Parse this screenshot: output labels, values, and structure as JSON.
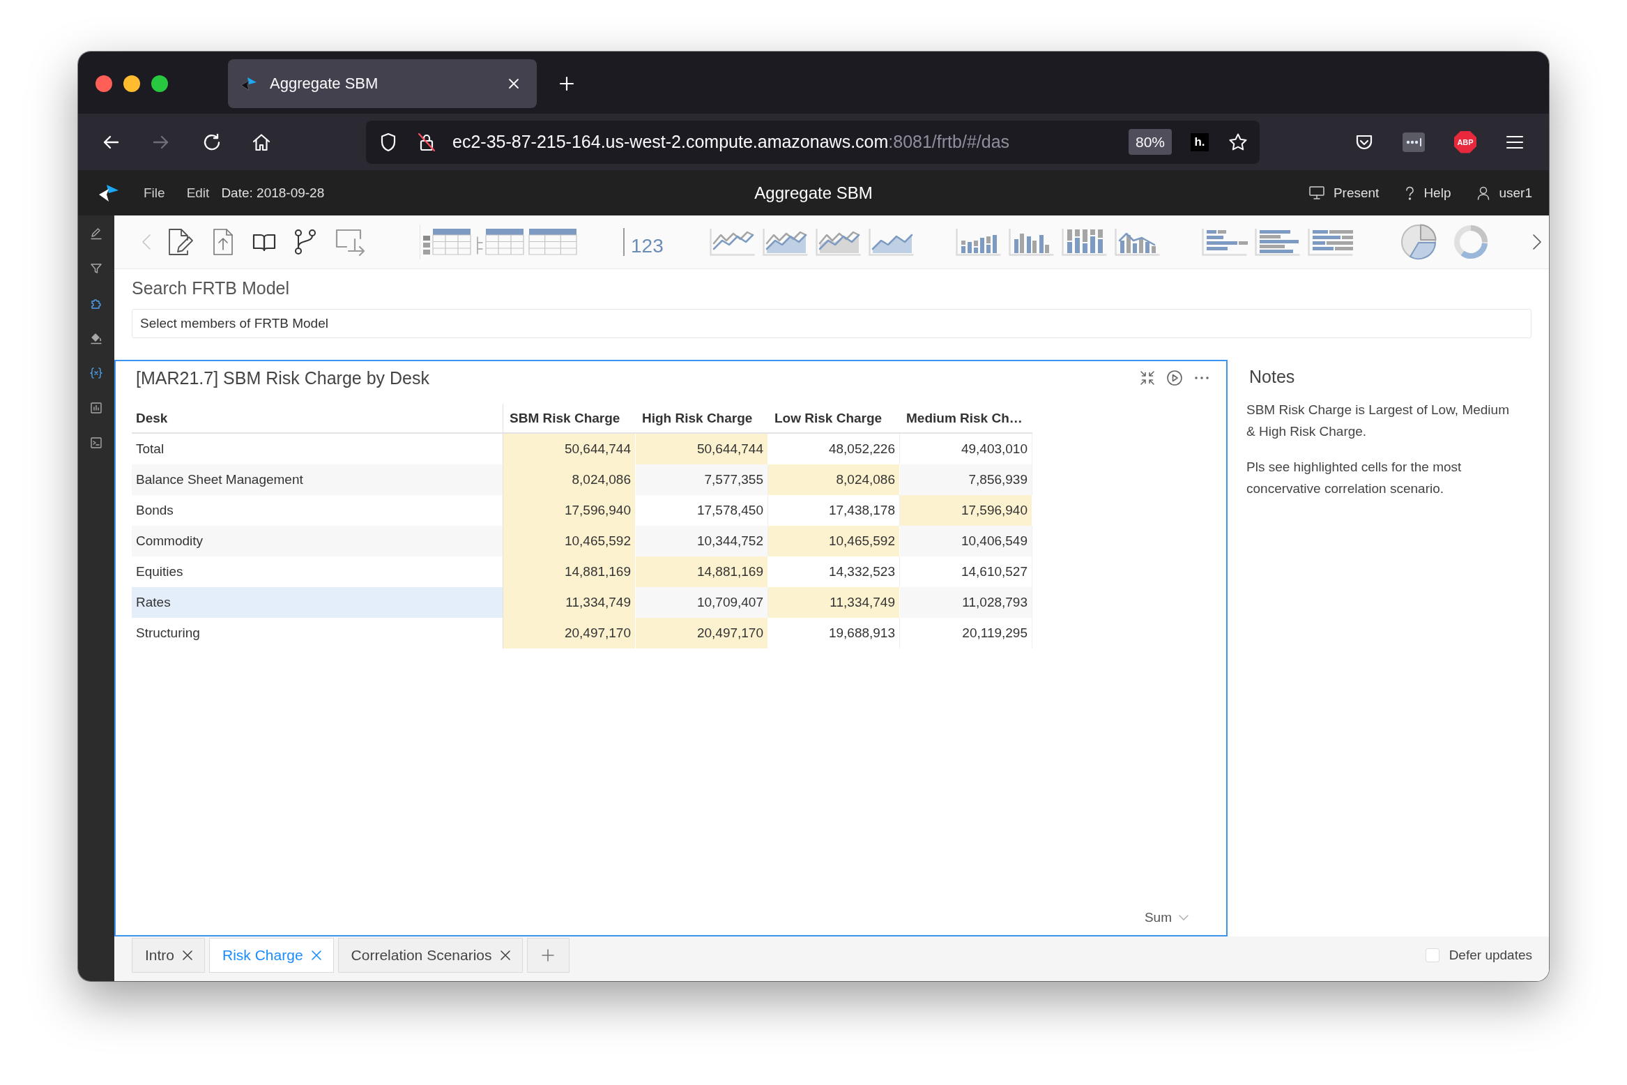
{
  "browser": {
    "tabs": [
      {
        "title": "Aggregate SBM",
        "selected": true
      }
    ],
    "url": {
      "host": "ec2-35-87-215-164.us-west-2.compute.amazonaws.com",
      "path": ":8081/frtb/#/das"
    },
    "zoom": "80%",
    "extensions": [
      {
        "kind": "square",
        "label": "h."
      },
      {
        "kind": "octagon",
        "label": "ABP"
      }
    ]
  },
  "app": {
    "menu": [
      "File",
      "Edit"
    ],
    "date": "Date: 2018-09-28",
    "title": "Aggregate SBM",
    "actions": [
      {
        "kind": "present",
        "label": "Present"
      },
      {
        "kind": "help",
        "label": "Help"
      },
      {
        "kind": "user",
        "label": "user1"
      }
    ]
  },
  "toolbar": {
    "kpi": "123"
  },
  "search": {
    "title": "Search FRTB Model",
    "placeholder": "Select members of FRTB Model"
  },
  "widget": {
    "title": "[MAR21.7] SBM Risk Charge by Desk",
    "columns": [
      "Desk",
      "SBM Risk Charge",
      "High Risk Charge",
      "Low Risk Charge",
      "Medium Risk Ch…"
    ],
    "rows": [
      {
        "selected": false,
        "cells": [
          {
            "value": "Total",
            "highlighted": false
          },
          {
            "value": "50,644,744",
            "highlighted": true
          },
          {
            "value": "50,644,744",
            "highlighted": true
          },
          {
            "value": "48,052,226",
            "highlighted": false
          },
          {
            "value": "49,403,010",
            "highlighted": false
          }
        ]
      },
      {
        "selected": false,
        "cells": [
          {
            "value": "Balance Sheet Management",
            "highlighted": false
          },
          {
            "value": "8,024,086",
            "highlighted": true
          },
          {
            "value": "7,577,355",
            "highlighted": false
          },
          {
            "value": "8,024,086",
            "highlighted": true
          },
          {
            "value": "7,856,939",
            "highlighted": false
          }
        ]
      },
      {
        "selected": false,
        "cells": [
          {
            "value": "Bonds",
            "highlighted": false
          },
          {
            "value": "17,596,940",
            "highlighted": true
          },
          {
            "value": "17,578,450",
            "highlighted": false
          },
          {
            "value": "17,438,178",
            "highlighted": false
          },
          {
            "value": "17,596,940",
            "highlighted": true
          }
        ]
      },
      {
        "selected": false,
        "cells": [
          {
            "value": "Commodity",
            "highlighted": false
          },
          {
            "value": "10,465,592",
            "highlighted": true
          },
          {
            "value": "10,344,752",
            "highlighted": false
          },
          {
            "value": "10,465,592",
            "highlighted": true
          },
          {
            "value": "10,406,549",
            "highlighted": false
          }
        ]
      },
      {
        "selected": false,
        "cells": [
          {
            "value": "Equities",
            "highlighted": false
          },
          {
            "value": "14,881,169",
            "highlighted": true
          },
          {
            "value": "14,881,169",
            "highlighted": true
          },
          {
            "value": "14,332,523",
            "highlighted": false
          },
          {
            "value": "14,610,527",
            "highlighted": false
          }
        ]
      },
      {
        "selected": true,
        "cells": [
          {
            "value": "Rates",
            "highlighted": false
          },
          {
            "value": "11,334,749",
            "highlighted": true
          },
          {
            "value": "10,709,407",
            "highlighted": false
          },
          {
            "value": "11,334,749",
            "highlighted": true
          },
          {
            "value": "11,028,793",
            "highlighted": false
          }
        ]
      },
      {
        "selected": false,
        "cells": [
          {
            "value": "Structuring",
            "highlighted": false
          },
          {
            "value": "20,497,170",
            "highlighted": true
          },
          {
            "value": "20,497,170",
            "highlighted": true
          },
          {
            "value": "19,688,913",
            "highlighted": false
          },
          {
            "value": "20,119,295",
            "highlighted": false
          }
        ]
      }
    ],
    "aggregation": "Sum"
  },
  "notes": {
    "title": "Notes",
    "paragraphs": [
      "SBM Risk Charge is Largest of Low, Medium & High Risk Charge.",
      "Pls see highlighted cells for the most concervative correlation scenario."
    ]
  },
  "sheets": {
    "tabs": [
      {
        "label": "Intro",
        "selected": false
      },
      {
        "label": "Risk Charge",
        "selected": true
      },
      {
        "label": "Correlation Scenarios",
        "selected": false
      }
    ]
  },
  "defer_updates": {
    "label": "Defer updates",
    "checked": false
  }
}
